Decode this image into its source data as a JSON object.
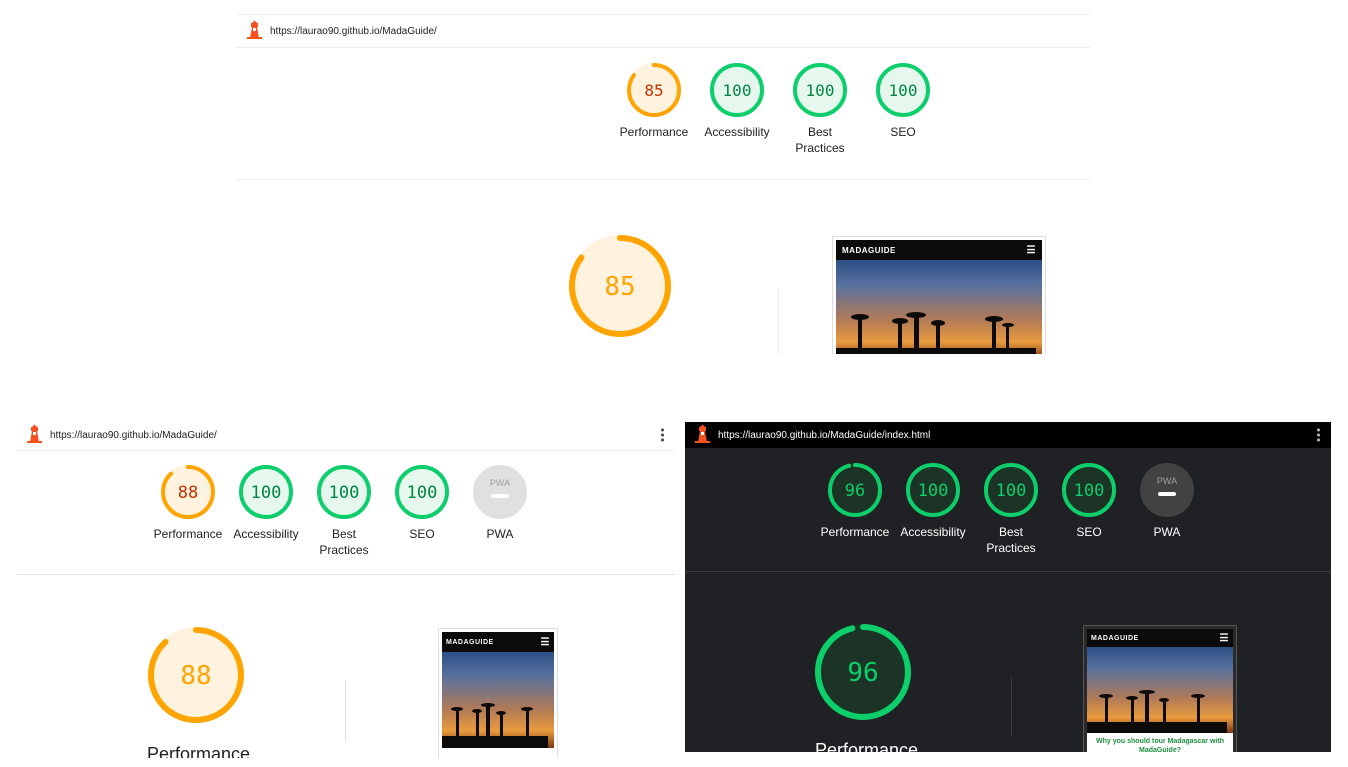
{
  "colors": {
    "orange": "#ffa400",
    "orange_text": "#c33300",
    "green": "#0cce6b",
    "green_text": "#018642",
    "gray": "#9e9e9e"
  },
  "report_top": {
    "url": "https://laurao90.github.io/MadaGuide/",
    "scores": [
      {
        "value": "85",
        "label": "Performance",
        "status": "average",
        "fraction": 0.85
      },
      {
        "value": "100",
        "label": "Accessibility",
        "status": "pass",
        "fraction": 1.0
      },
      {
        "value": "100",
        "label": "Best Practices",
        "status": "pass",
        "fraction": 1.0
      },
      {
        "value": "100",
        "label": "SEO",
        "status": "pass",
        "fraction": 1.0
      }
    ],
    "big_score": {
      "value": "85",
      "fraction": 0.85
    },
    "screenshot": {
      "logo": "MADAGUIDE",
      "menu_icon": "hamburger-icon"
    }
  },
  "report_left": {
    "url": "https://laurao90.github.io/MadaGuide/",
    "scores": [
      {
        "value": "88",
        "label": "Performance",
        "status": "average",
        "fraction": 0.88
      },
      {
        "value": "100",
        "label": "Accessibility",
        "status": "pass",
        "fraction": 1.0
      },
      {
        "value": "100",
        "label": "Best Practices",
        "status": "pass",
        "fraction": 1.0
      },
      {
        "value": "100",
        "label": "SEO",
        "status": "pass",
        "fraction": 1.0
      },
      {
        "value": "PWA",
        "label": "PWA",
        "status": "na"
      }
    ],
    "big_score": {
      "value": "88",
      "fraction": 0.88
    },
    "big_label": "Performance",
    "screenshot": {
      "logo": "MADAGUIDE",
      "menu_icon": "hamburger-icon"
    }
  },
  "report_right": {
    "url": "https://laurao90.github.io/MadaGuide/index.html",
    "theme": "dark",
    "scores": [
      {
        "value": "96",
        "label": "Performance",
        "status": "pass",
        "fraction": 0.96
      },
      {
        "value": "100",
        "label": "Accessibility",
        "status": "pass",
        "fraction": 1.0
      },
      {
        "value": "100",
        "label": "Best Practices",
        "status": "pass",
        "fraction": 1.0
      },
      {
        "value": "100",
        "label": "SEO",
        "status": "pass",
        "fraction": 1.0
      },
      {
        "value": "PWA",
        "label": "PWA",
        "status": "na"
      }
    ],
    "big_score": {
      "value": "96",
      "fraction": 0.96
    },
    "big_label": "Performance",
    "screenshot": {
      "logo": "MADAGUIDE",
      "menu_icon": "hamburger-icon",
      "caption": "Why you should tour Madagascar with MadaGuide?"
    }
  }
}
